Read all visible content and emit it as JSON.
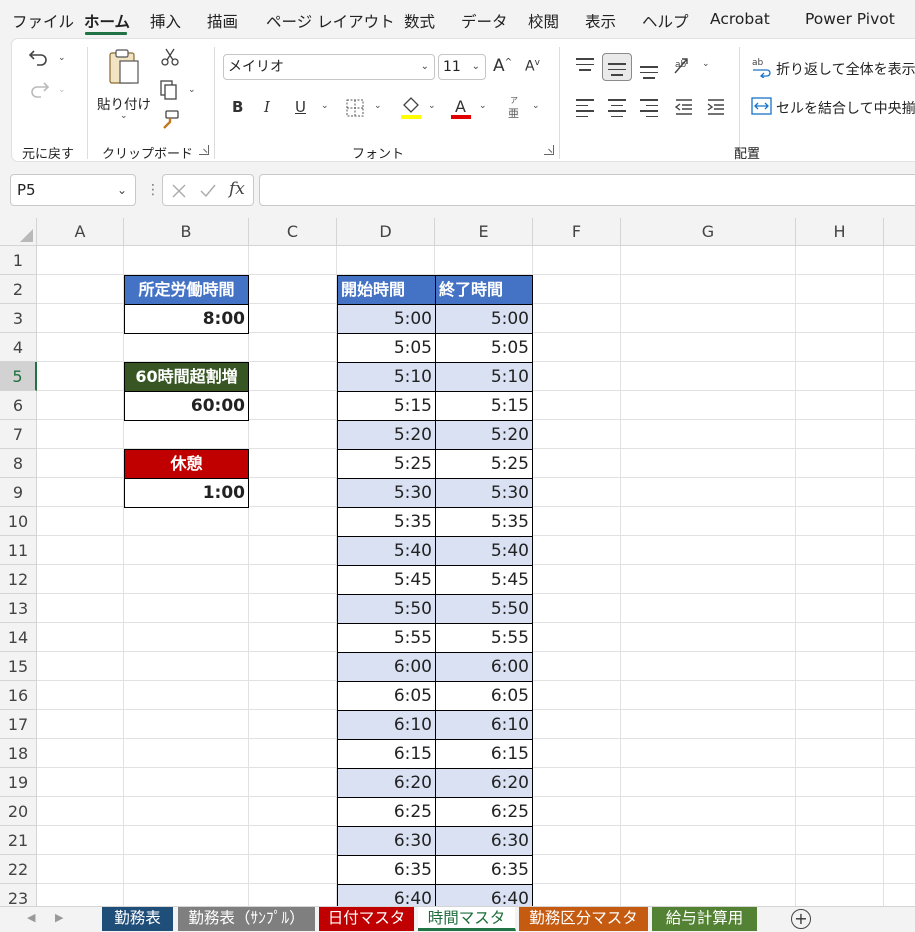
{
  "menu": {
    "tabs": [
      "ファイル",
      "ホーム",
      "挿入",
      "描画",
      "ページ レイアウト",
      "数式",
      "データ",
      "校閲",
      "表示",
      "ヘルプ",
      "Acrobat",
      "Power Pivot"
    ],
    "active_tab": "ホーム"
  },
  "ribbon": {
    "undo_group_label": "元に戻す",
    "clipboard": {
      "paste_label": "貼り付け",
      "group_label": "クリップボード"
    },
    "font": {
      "name": "メイリオ",
      "size": "11",
      "phonetic_glyph": "亜",
      "phonetic_ruby": "ア",
      "group_label": "フォント"
    },
    "alignment": {
      "wrap_text_label": "折り返して全体を表示す",
      "merge_label": "セルを結合して中央揃え",
      "group_label": "配置"
    },
    "highlight_color": "#ffff00",
    "font_color": "#e00000"
  },
  "formula_bar": {
    "name_box": "P5",
    "fx_label": "fx",
    "formula": ""
  },
  "grid": {
    "columns": [
      "A",
      "B",
      "C",
      "D",
      "E",
      "F",
      "G",
      "H"
    ],
    "rows": [
      "1",
      "2",
      "3",
      "4",
      "5",
      "6",
      "7",
      "8",
      "9",
      "10",
      "11",
      "12",
      "13",
      "14",
      "15",
      "16",
      "17",
      "18",
      "19",
      "20",
      "21",
      "22",
      "23"
    ],
    "selected_row": "5",
    "cells": {
      "b2": "所定労働時間",
      "b3": "8:00",
      "b5": "60時間超割増",
      "b6": "60:00",
      "b8": "休憩",
      "b9": "1:00"
    },
    "time_table": {
      "header_start": "開始時間",
      "header_end": "終了時間",
      "start_times": [
        "5:00",
        "5:05",
        "5:10",
        "5:15",
        "5:20",
        "5:25",
        "5:30",
        "5:35",
        "5:40",
        "5:45",
        "5:50",
        "5:55",
        "6:00",
        "6:05",
        "6:10",
        "6:15",
        "6:20",
        "6:25",
        "6:30",
        "6:35",
        "6:40"
      ],
      "end_times": [
        "5:00",
        "5:05",
        "5:10",
        "5:15",
        "5:20",
        "5:25",
        "5:30",
        "5:35",
        "5:40",
        "5:45",
        "5:50",
        "5:55",
        "6:00",
        "6:05",
        "6:10",
        "6:15",
        "6:20",
        "6:25",
        "6:30",
        "6:35",
        "6:40"
      ]
    },
    "colors": {
      "header_blue": "#4472c4",
      "header_green": "#375623",
      "header_red": "#c00000",
      "band_blue": "#d9e1f2"
    }
  },
  "sheets": [
    {
      "name": "勤務表",
      "color": "#1f4e79"
    },
    {
      "name": "勤務表（ｻﾝﾌﾟﾙ）",
      "color": "#7f7f7f"
    },
    {
      "name": "日付マスタ",
      "color": "#c00000"
    },
    {
      "name": "時間マスタ",
      "color": "#548235",
      "active": true
    },
    {
      "name": "勤務区分マスタ",
      "color": "#c55a11"
    },
    {
      "name": "給与計算用",
      "color": "#548235"
    }
  ]
}
